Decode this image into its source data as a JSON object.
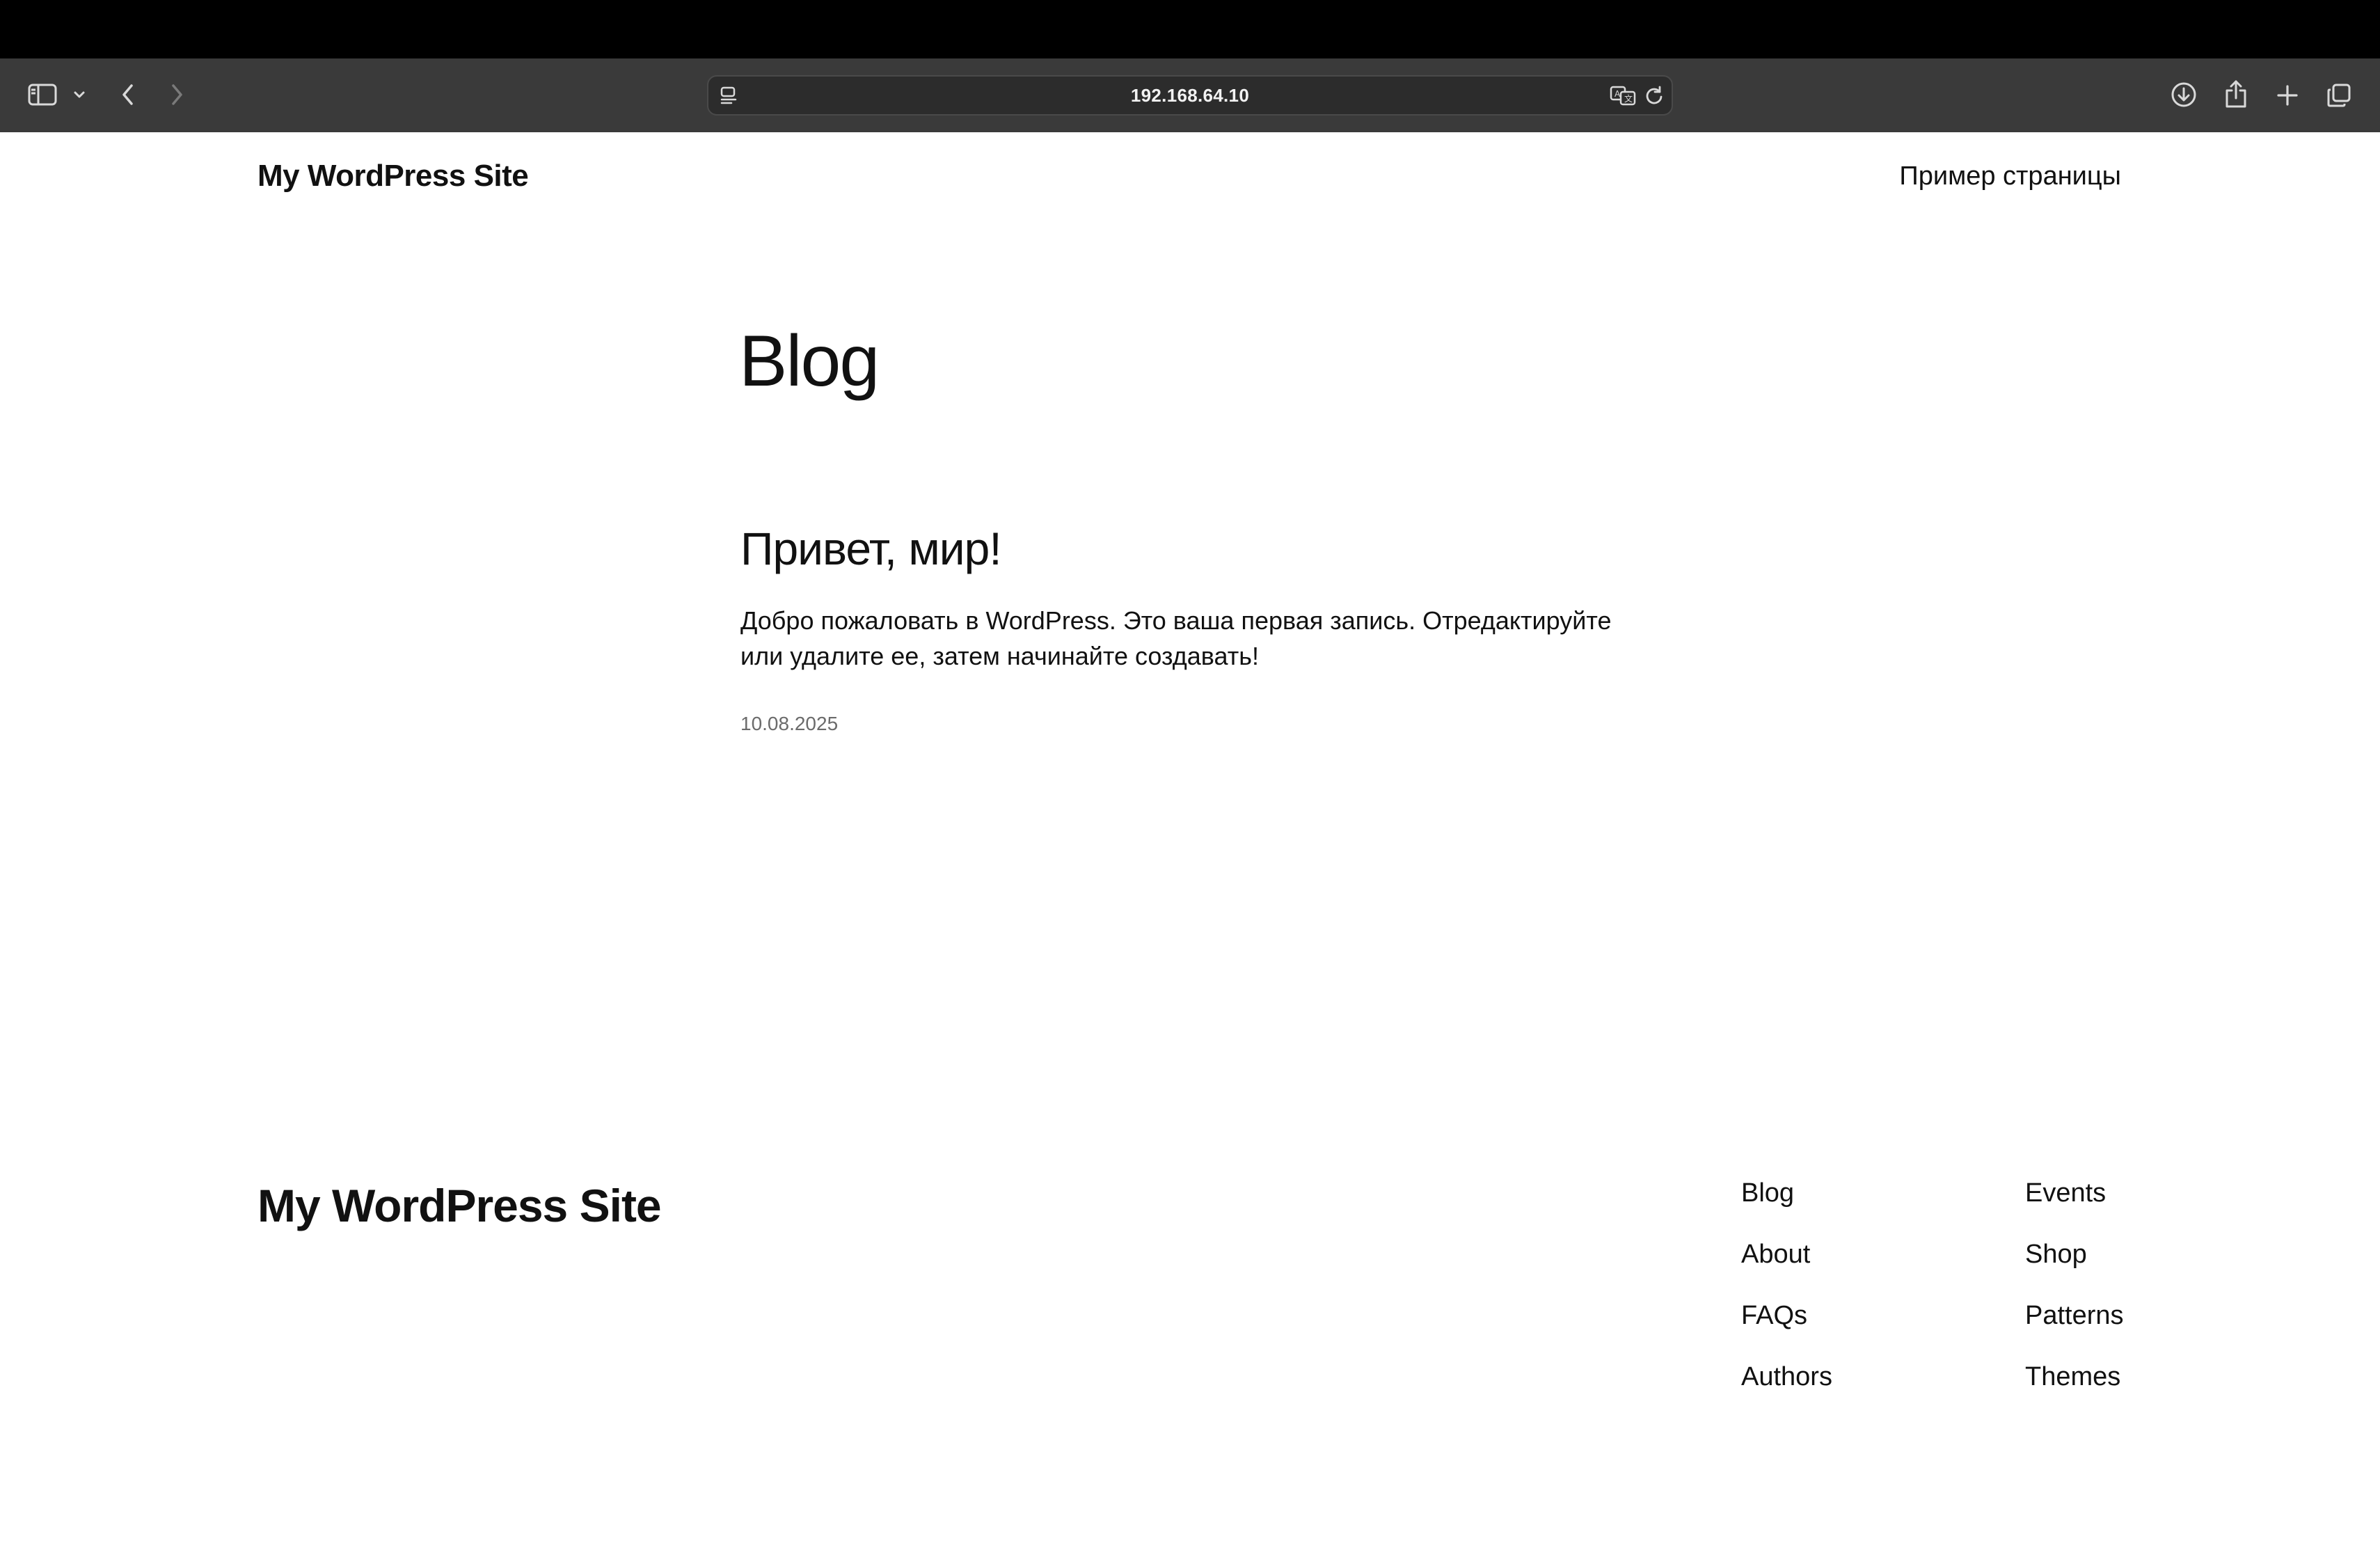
{
  "browser": {
    "address": "192.168.64.10",
    "icons": {
      "sidebar": "sidebar-icon",
      "sidebar_menu": "chevron-down-icon",
      "back": "chevron-left-icon",
      "forward": "chevron-right-icon",
      "site_settings": "page-settings-icon",
      "translate": "translate-icon",
      "reload": "reload-icon",
      "downloads": "download-icon",
      "share": "share-icon",
      "new_tab": "plus-icon",
      "tab_overview": "tabs-icon"
    }
  },
  "header": {
    "site_title": "My WordPress Site",
    "nav_link": "Пример страницы"
  },
  "main": {
    "heading": "Blog",
    "post": {
      "title": "Привет, мир!",
      "excerpt": "Добро пожаловать в WordPress. Это ваша первая запись. Отредактируйте или удалите ее, затем начинайте создавать!",
      "date": "10.08.2025"
    }
  },
  "footer": {
    "site_title": "My WordPress Site",
    "column1": [
      "Blog",
      "About",
      "FAQs",
      "Authors"
    ],
    "column2": [
      "Events",
      "Shop",
      "Patterns",
      "Themes"
    ]
  }
}
